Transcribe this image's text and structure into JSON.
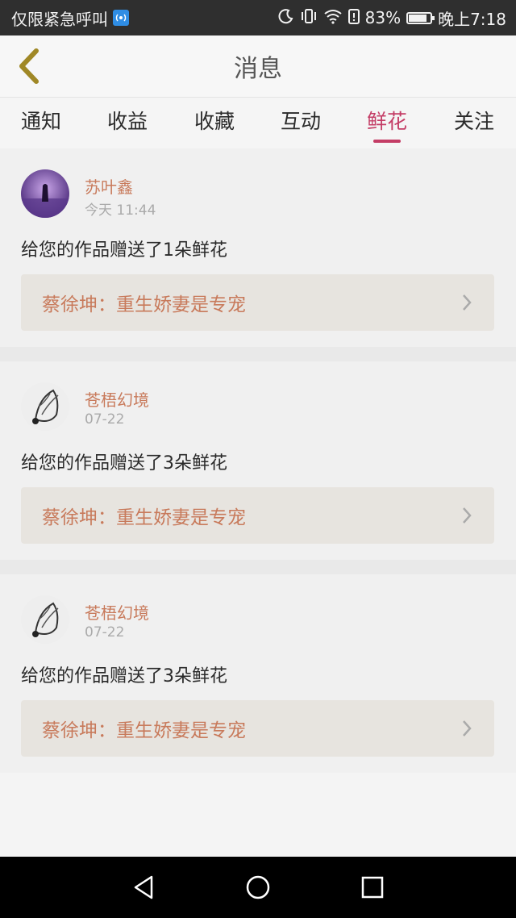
{
  "status_bar": {
    "emergency_text": "仅限紧急呼叫",
    "battery": "83%",
    "battery_level": 0.83,
    "time": "晚上7:18"
  },
  "header": {
    "title": "消息"
  },
  "tabs": [
    {
      "label": "通知",
      "active": false
    },
    {
      "label": "收益",
      "active": false
    },
    {
      "label": "收藏",
      "active": false
    },
    {
      "label": "互动",
      "active": false
    },
    {
      "label": "鲜花",
      "active": true
    },
    {
      "label": "关注",
      "active": false
    }
  ],
  "messages": [
    {
      "name": "苏叶鑫",
      "time": "今天 11:44",
      "text": "给您的作品赠送了1朵鲜花",
      "work": "蔡徐坤：重生娇妻是专宠"
    },
    {
      "name": "苍梧幻境",
      "time": "07-22",
      "text": "给您的作品赠送了3朵鲜花",
      "work": "蔡徐坤：重生娇妻是专宠"
    },
    {
      "name": "苍梧幻境",
      "time": "07-22",
      "text": "给您的作品赠送了3朵鲜花",
      "work": "蔡徐坤：重生娇妻是专宠"
    }
  ],
  "colors": {
    "accent": "#c43d66",
    "name": "#c87a5b"
  }
}
